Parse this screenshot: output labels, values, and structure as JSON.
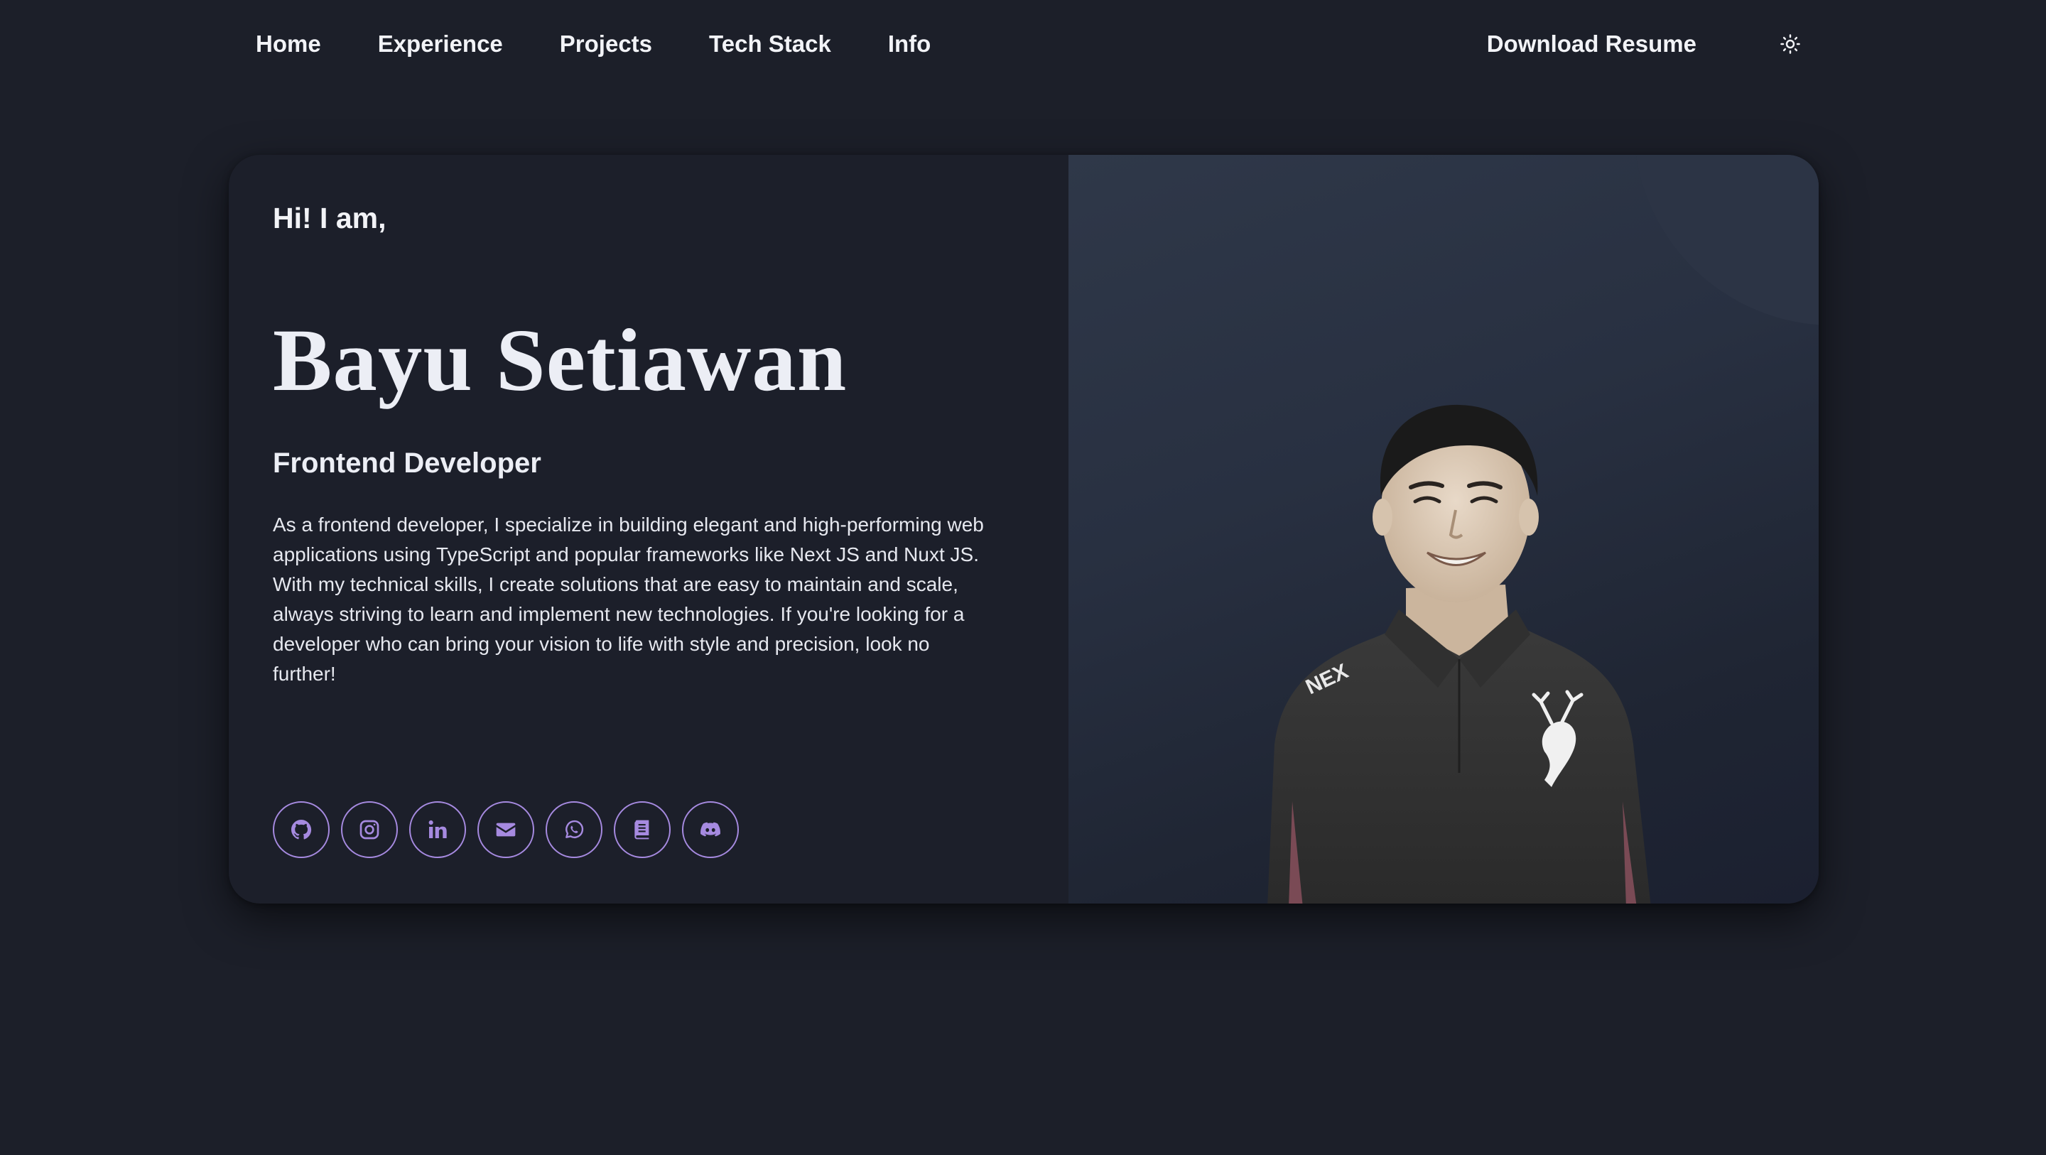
{
  "nav": {
    "links": [
      {
        "label": "Home"
      },
      {
        "label": "Experience"
      },
      {
        "label": "Projects"
      },
      {
        "label": "Tech Stack"
      },
      {
        "label": "Info"
      }
    ],
    "resume_label": "Download Resume",
    "theme_icon": "sun-icon"
  },
  "hero": {
    "greeting": "Hi! I am,",
    "name": "Bayu Setiawan",
    "role": "Frontend Developer",
    "bio": "As a frontend developer, I specialize in building elegant and high-performing web applications using TypeScript and popular frameworks like Next JS and Nuxt JS. With my technical skills, I create solutions that are easy to maintain and scale, always striving to learn and implement new technologies. If you're looking for a developer who can bring your vision to life with style and precision, look no further!",
    "socials": [
      {
        "icon": "github-icon"
      },
      {
        "icon": "instagram-icon"
      },
      {
        "icon": "linkedin-icon"
      },
      {
        "icon": "email-icon"
      },
      {
        "icon": "whatsapp-icon"
      },
      {
        "icon": "book-icon"
      },
      {
        "icon": "discord-icon"
      }
    ]
  },
  "colors": {
    "background": "#1c1f29",
    "accent": "#a68ae0",
    "text": "#eceef5"
  }
}
